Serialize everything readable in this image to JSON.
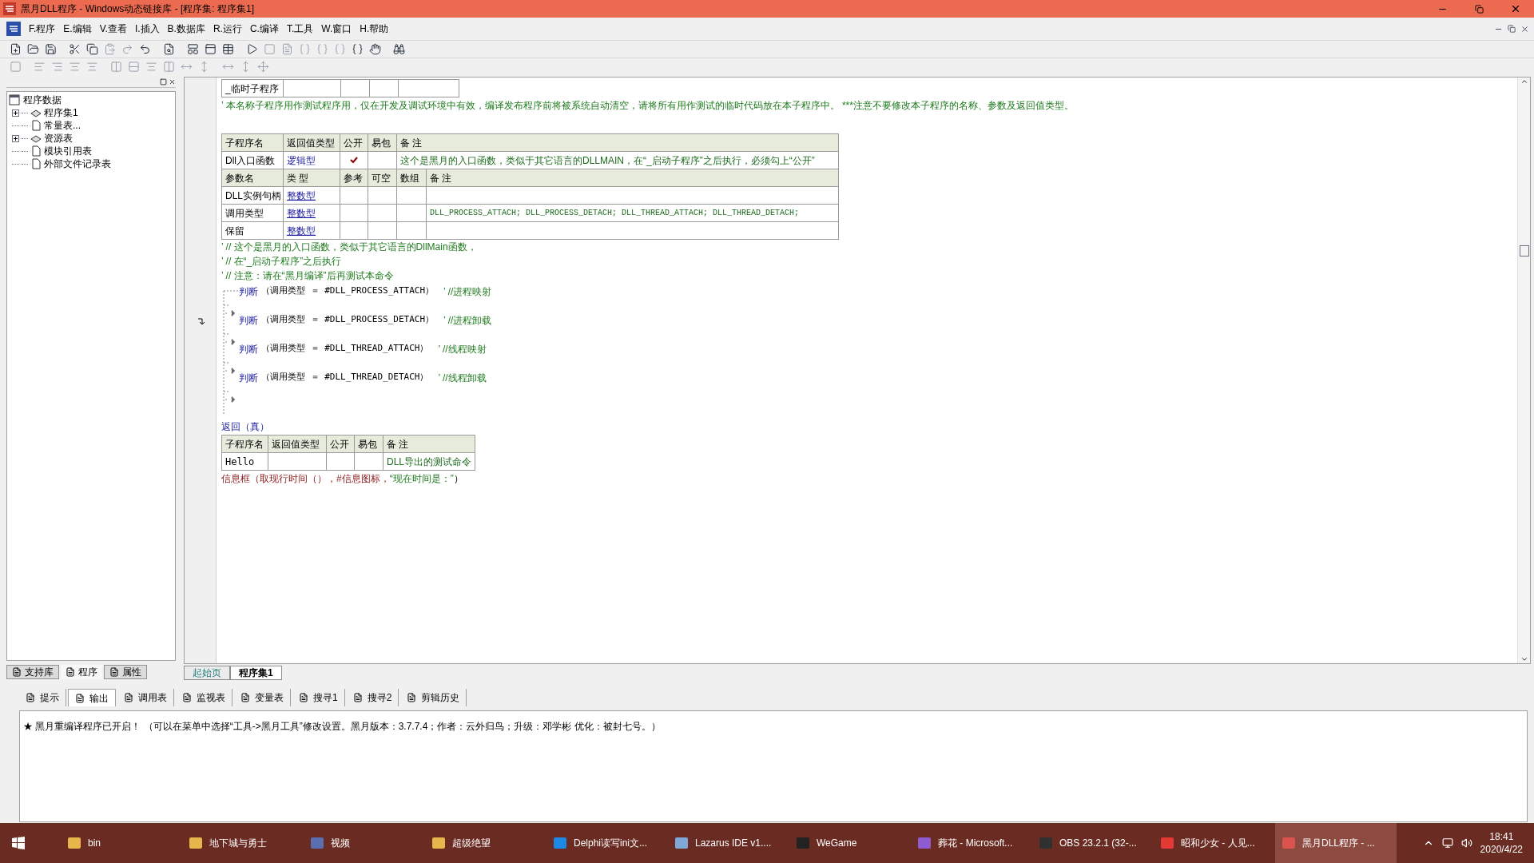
{
  "window": {
    "title": "黑月DLL程序 - Windows动态链接库 - [程序集: 程序集1]"
  },
  "menu": [
    "F.程序",
    "E.编辑",
    "V.查看",
    "I.插入",
    "B.数据库",
    "R.运行",
    "C.编译",
    "T.工具",
    "W.窗口",
    "H.帮助"
  ],
  "tree": {
    "label": "程序数据",
    "children": [
      {
        "label": "程序集1",
        "kind": "group",
        "expanded": false
      },
      {
        "label": "常量表...",
        "kind": "leaf"
      },
      {
        "label": "资源表",
        "kind": "group",
        "expanded": false
      },
      {
        "label": "模块引用表",
        "kind": "leaf"
      },
      {
        "label": "外部文件记录表",
        "kind": "leaf"
      }
    ]
  },
  "left_tabs": [
    {
      "label": "支持库",
      "selected": false
    },
    {
      "label": "程序",
      "selected": true
    },
    {
      "label": "属性",
      "selected": false
    }
  ],
  "editor": {
    "temp_sub": {
      "name": "_临时子程序"
    },
    "temp_note": "’ 本名称子程序用作测试程序用，仅在开发及调试环境中有效，编译发布程序前将被系统自动清空，请将所有用作测试的临时代码放在本子程序中。 ***注意不要修改本子程序的名称、参数及返回值类型。",
    "entry_sub": {
      "columns": [
        "子程序名",
        "返回值类型",
        "公开",
        "易包",
        "备 注"
      ],
      "name": "Dll入口函数",
      "return_type": "逻辑型",
      "public": true,
      "note": "这个是黑月的入口函数，类似于其它语言的DLLMAIN，在“_启动子程序”之后执行，必须勾上“公开”"
    },
    "params": {
      "columns": [
        "参数名",
        "类 型",
        "参考",
        "可空",
        "数组",
        "备 注"
      ],
      "rows": [
        {
          "name": "DLL实例句柄",
          "type": "整数型"
        },
        {
          "name": "调用类型",
          "type": "整数型",
          "note": "DLL_PROCESS_ATTACH; DLL_PROCESS_DETACH; DLL_THREAD_ATTACH; DLL_THREAD_DETACH;"
        },
        {
          "name": "保留",
          "type": "整数型"
        }
      ]
    },
    "comments": [
      "’ // 这个是黑月的入口函数，类似于其它语言的DllMain函数，",
      "’ // 在“_启动子程序”之后执行",
      "’ // 注意：请在“黑月编译”后再测试本命令"
    ],
    "branches": [
      {
        "keyword": "判断",
        "condition": "（调用类型 ＝ #DLL_PROCESS_ATTACH）",
        "comment": "’ //进程映射"
      },
      {
        "keyword": "判断",
        "condition": "（调用类型 ＝ #DLL_PROCESS_DETACH）",
        "comment": "’ //进程卸载"
      },
      {
        "keyword": "判断",
        "condition": "（调用类型 ＝ #DLL_THREAD_ATTACH）",
        "comment": "’ //线程映射"
      },
      {
        "keyword": "判断",
        "condition": "（调用类型 ＝ #DLL_THREAD_DETACH）",
        "comment": "’ //线程卸载"
      }
    ],
    "return_stmt": "返回（真）",
    "hello_sub": {
      "columns": [
        "子程序名",
        "返回值类型",
        "公开",
        "易包",
        "备 注"
      ],
      "name": "Hello",
      "note": "DLL导出的测试命令"
    },
    "call": {
      "function": "信息框",
      "args": "（取现行时间（），#信息图标，",
      "string": "“现在时间是：”",
      "close": "）"
    }
  },
  "doc_tabs": [
    {
      "label": "起始页",
      "selected": false
    },
    {
      "label": "程序集1",
      "selected": true
    }
  ],
  "output_tabs": [
    {
      "label": "提示",
      "selected": false
    },
    {
      "label": "输出",
      "selected": true
    },
    {
      "label": "调用表",
      "selected": false
    },
    {
      "label": "监视表",
      "selected": false
    },
    {
      "label": "变量表",
      "selected": false
    },
    {
      "label": "搜寻1",
      "selected": false
    },
    {
      "label": "搜寻2",
      "selected": false
    },
    {
      "label": "剪辑历史",
      "selected": false
    }
  ],
  "output_lines": [
    "★ 黑月重编译程序已开启！ （可以在菜单中选择“工具->黑月工具”修改设置。黑月版本：3.7.7.4；作者：云外归鸟；升级：邓学彬 优化：被封七号。）"
  ],
  "taskbar": {
    "items": [
      {
        "label": "bin",
        "color": "#e8b64a",
        "selected": false
      },
      {
        "label": "地下城与勇士",
        "color": "#e8b64a",
        "selected": false
      },
      {
        "label": "视频",
        "color": "#5a6fb0",
        "selected": false
      },
      {
        "label": "超级绝望",
        "color": "#e8b64a",
        "selected": false
      },
      {
        "label": "Delphi读写ini文...",
        "color": "#1e88e5",
        "selected": false
      },
      {
        "label": "Lazarus IDE v1....",
        "color": "#7fa7d8",
        "selected": false
      },
      {
        "label": "WeGame",
        "color": "#222222",
        "selected": false
      },
      {
        "label": "葬花 - Microsoft...",
        "color": "#8e5bd0",
        "selected": false
      },
      {
        "label": "OBS 23.2.1 (32-...",
        "color": "#303030",
        "selected": false
      },
      {
        "label": "昭和少女 - 人见...",
        "color": "#e53935",
        "selected": false
      },
      {
        "label": "黑月DLL程序 - ...",
        "color": "#d9534f",
        "selected": true
      }
    ],
    "time": "18:41",
    "date": "2020/4/22"
  }
}
